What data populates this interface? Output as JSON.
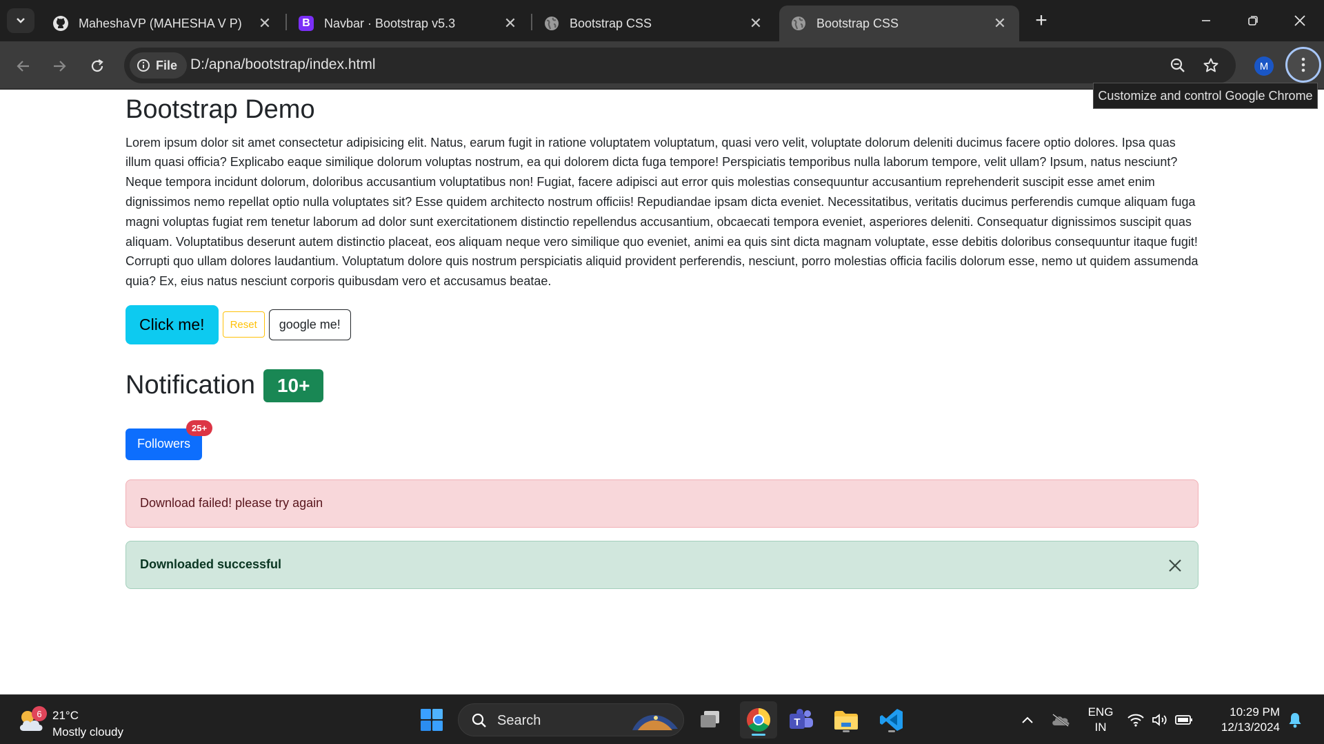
{
  "browser": {
    "tabs": [
      {
        "title": "MaheshaVP (MAHESHA V P)",
        "icon": "github-icon"
      },
      {
        "title": "Navbar · Bootstrap v5.3",
        "icon": "bootstrap-icon"
      },
      {
        "title": "Bootstrap CSS",
        "icon": "globe-icon"
      },
      {
        "title": "Bootstrap CSS",
        "icon": "globe-icon",
        "active": true
      }
    ],
    "chip_label": "File",
    "url": "D:/apna/bootstrap/index.html",
    "avatar_letter": "M",
    "tooltip": "Customize and control Google Chrome"
  },
  "page": {
    "heading": "Bootstrap Demo",
    "paragraph": "Lorem ipsum dolor sit amet consectetur adipisicing elit. Natus, earum fugit in ratione voluptatem voluptatum, quasi vero velit, voluptate dolorum deleniti ducimus facere optio dolores. Ipsa quas illum quasi officia? Explicabo eaque similique dolorum voluptas nostrum, ea qui dolorem dicta fuga tempore! Perspiciatis temporibus nulla laborum tempore, velit ullam? Ipsum, natus nesciunt? Neque tempora incidunt dolorum, doloribus accusantium voluptatibus non! Fugiat, facere adipisci aut error quis molestias consequuntur accusantium reprehenderit suscipit esse amet enim dignissimos nemo repellat optio nulla voluptates sit? Esse quidem architecto nostrum officiis! Repudiandae ipsam dicta eveniet. Necessitatibus, veritatis ducimus perferendis cumque aliquam fuga magni voluptas fugiat rem tenetur laborum ad dolor sunt exercitationem distinctio repellendus accusantium, obcaecati tempora eveniet, asperiores deleniti. Consequatur dignissimos suscipit quas aliquam. Voluptatibus deserunt autem distinctio placeat, eos aliquam neque vero similique quo eveniet, animi ea quis sint dicta magnam voluptate, esse debitis doloribus consequuntur itaque fugit! Corrupti quo ullam dolores laudantium. Voluptatum dolore quis nostrum perspiciatis aliquid provident perferendis, nesciunt, porro molestias officia facilis dolorum esse, nemo ut quidem assumenda quia? Ex, eius natus nesciunt corporis quibusdam vero et accusamus beatae.",
    "buttons": {
      "click": "Click me!",
      "reset": "Reset",
      "google": "google me!"
    },
    "notification": {
      "heading": "Notification",
      "badge": "10+"
    },
    "followers": {
      "label": "Followers",
      "badge": "25+"
    },
    "alerts": {
      "danger": "Download failed! please try again",
      "success": "Downloaded successful"
    },
    "colors": {
      "info": "#0dcaf0",
      "warning": "#ffc107",
      "primary": "#0d6efd",
      "success": "#198754",
      "danger": "#dc3545"
    }
  },
  "taskbar": {
    "weather": {
      "temp": "21°C",
      "condition": "Mostly cloudy",
      "badge": "6"
    },
    "search_label": "Search",
    "lang": {
      "line1": "ENG",
      "line2": "IN"
    },
    "clock": {
      "time": "10:29 PM",
      "date": "12/13/2024"
    }
  }
}
